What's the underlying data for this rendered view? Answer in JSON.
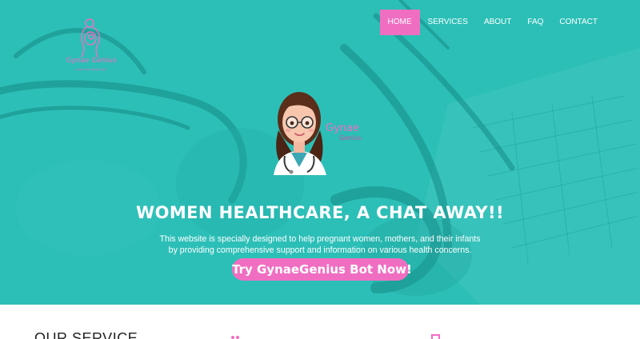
{
  "brand": {
    "name": "Gynae Genius",
    "tagline": "Know Your Body Care",
    "accent_color": "#f06ec2",
    "hero_color": "#2bbdb5"
  },
  "nav": {
    "items": [
      {
        "label": "HOME",
        "active": true
      },
      {
        "label": "SERVICES",
        "active": false
      },
      {
        "label": "ABOUT",
        "active": false
      },
      {
        "label": "FAQ",
        "active": false
      },
      {
        "label": "CONTACT",
        "active": false
      }
    ]
  },
  "hero": {
    "avatar_label_line1": "Gynae",
    "avatar_label_line2": "Genius",
    "headline": "WOMEN HEALTHCARE, A CHAT AWAY!!",
    "subtext_line1": "This website is specially designed to help pregnant women, mothers, and their infants",
    "subtext_line2": "by providing comprehensive support and information on various health concerns.",
    "cta_label": "Try GynaeGenius Bot Now!"
  },
  "services": {
    "title": "OUR SERVICE"
  }
}
